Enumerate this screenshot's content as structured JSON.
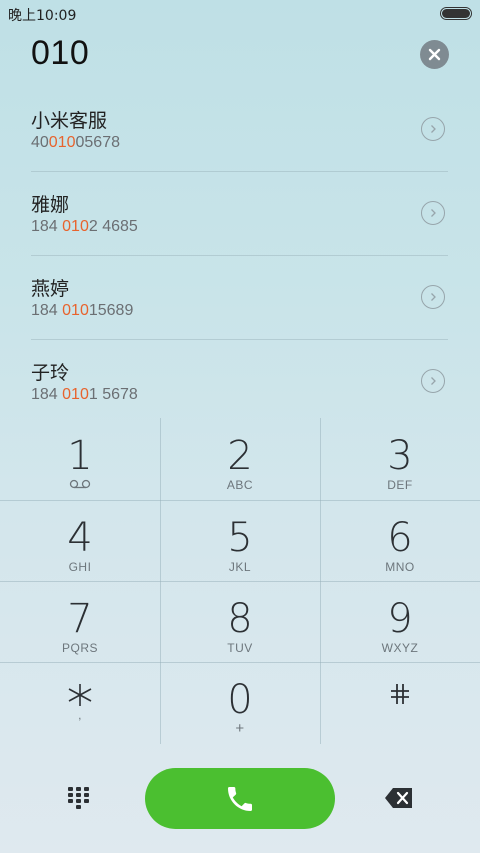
{
  "status": {
    "time": "晚上10:09"
  },
  "dialer": {
    "number": "010",
    "results": [
      {
        "name": "小米客服",
        "number_pre": "40",
        "number_match": "010",
        "number_post": "05678"
      },
      {
        "name": "雅娜",
        "number_pre": "184 ",
        "number_match": "010",
        "number_post": "2 4685"
      },
      {
        "name": "燕婷",
        "number_pre": "184 ",
        "number_match": "010",
        "number_post": "15689"
      },
      {
        "name": "子玲",
        "number_pre": "184 ",
        "number_match": "010",
        "number_post": "1 5678"
      }
    ]
  },
  "keypad": {
    "keys": [
      {
        "digit": "1",
        "letters": ""
      },
      {
        "digit": "2",
        "letters": "ABC"
      },
      {
        "digit": "3",
        "letters": "DEF"
      },
      {
        "digit": "4",
        "letters": "GHI"
      },
      {
        "digit": "5",
        "letters": "JKL"
      },
      {
        "digit": "6",
        "letters": "MNO"
      },
      {
        "digit": "7",
        "letters": "PQRS"
      },
      {
        "digit": "8",
        "letters": "TUV"
      },
      {
        "digit": "9",
        "letters": "WXYZ"
      },
      {
        "digit": "",
        "letters": ","
      },
      {
        "digit": "0",
        "letters": "+"
      },
      {
        "digit": "",
        "letters": ""
      }
    ]
  },
  "colors": {
    "accent_match": "#e8632d",
    "call_green": "#4bbf30"
  },
  "icons": {
    "voicemail": "voicemail-icon",
    "star": "star-icon",
    "hash": "hash-icon",
    "dialpad": "dialpad-grid-icon",
    "call": "phone-icon",
    "delete": "backspace-icon",
    "clear": "clear-icon",
    "arrow": "chevron-right-circle-icon"
  }
}
